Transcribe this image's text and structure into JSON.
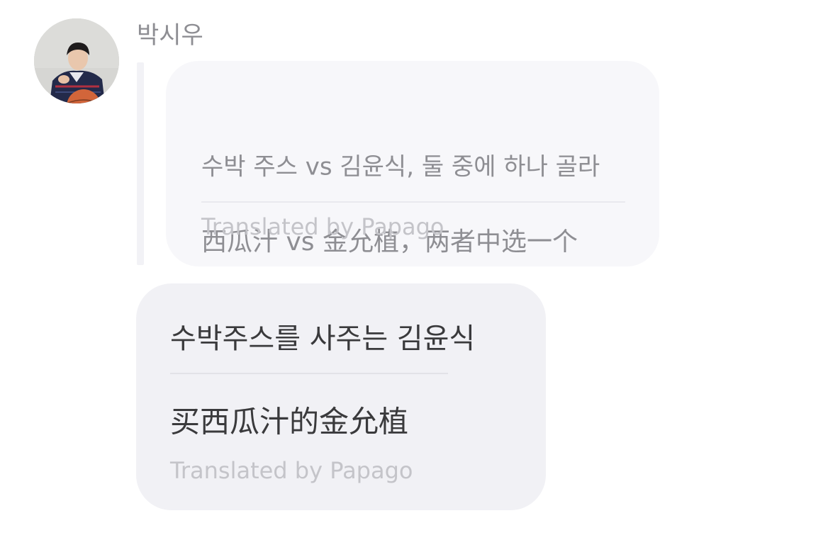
{
  "sender": {
    "name": "박시우",
    "avatar_icon": "profile-photo"
  },
  "reply_quote": {
    "original_text": "수박 주스 vs 김윤식, 둘 중에 하나 골라",
    "translated_text": "西瓜汁 vs 金允植，两者中选一个",
    "credit": "Translated by Papago"
  },
  "message": {
    "original_text": "수박주스를 사주는 김윤식",
    "translated_text": "买西瓜汁的金允植",
    "credit": "Translated by Papago"
  },
  "colors": {
    "name_text": "#8e8e93",
    "quote_bubble_bg": "#f7f7fa",
    "message_bubble_bg": "#f1f1f5",
    "message_text": "#3a3a3c",
    "credit_text": "#c4c4c9"
  }
}
